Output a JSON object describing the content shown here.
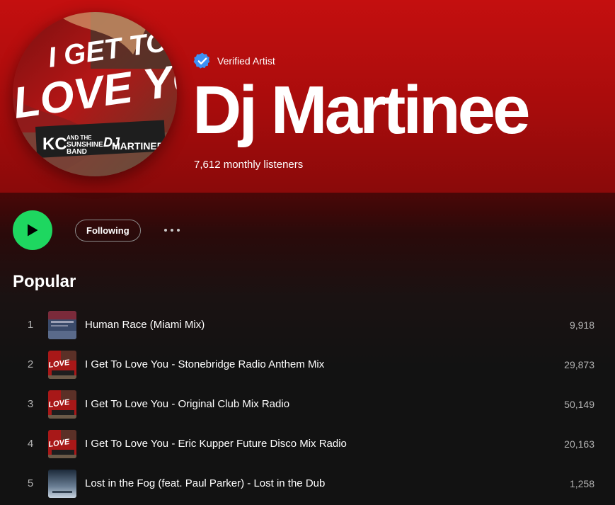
{
  "colors": {
    "header_bg": "#b50d0d",
    "play_green": "#1ed760",
    "verified_blue": "#3d91f4",
    "body_bg": "#121212"
  },
  "header": {
    "verified_label": "Verified Artist",
    "artist_name": "Dj Martinee",
    "monthly_listeners": "7,612 monthly listeners",
    "avatar_icon": "artist-cover-image"
  },
  "actions": {
    "play_icon": "play-icon",
    "follow_label": "Following",
    "more_icon": "more-options-icon"
  },
  "popular": {
    "title": "Popular",
    "tracks": [
      {
        "rank": "1",
        "title": "Human Race (Miami Mix)",
        "plays": "9,918",
        "art": "human-race-art"
      },
      {
        "rank": "2",
        "title": "I Get To Love You - Stonebridge Radio Anthem Mix",
        "plays": "29,873",
        "art": "i-get-to-love-you-art"
      },
      {
        "rank": "3",
        "title": "I Get To Love You - Original Club Mix Radio",
        "plays": "50,149",
        "art": "i-get-to-love-you-art"
      },
      {
        "rank": "4",
        "title": "I Get To Love You - Eric Kupper Future Disco Mix Radio",
        "plays": "20,163",
        "art": "i-get-to-love-you-art"
      },
      {
        "rank": "5",
        "title": "Lost in the Fog (feat. Paul Parker) - Lost in the Dub",
        "plays": "1,258",
        "art": "lost-in-the-fog-art"
      }
    ]
  }
}
